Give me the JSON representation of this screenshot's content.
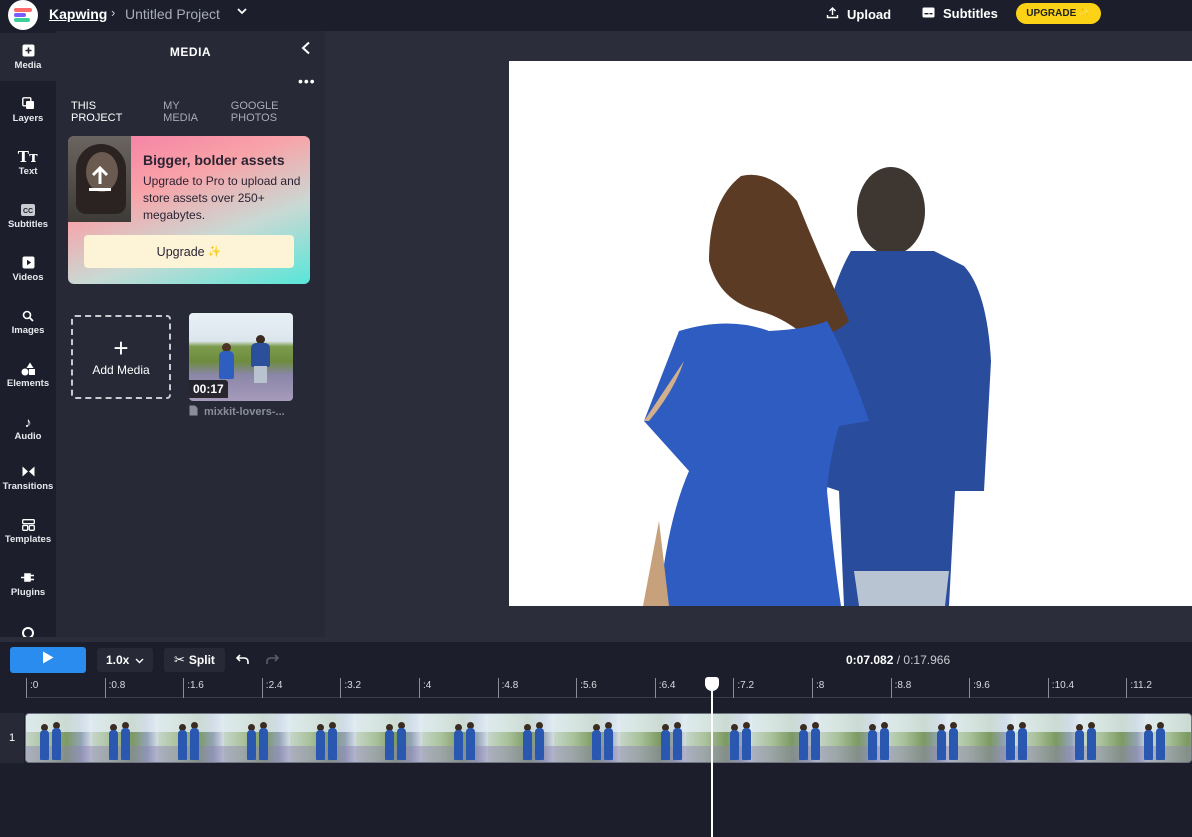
{
  "header": {
    "brand": "Kapwing",
    "separator": "›",
    "project_name": "Untitled Project",
    "upload_label": "Upload",
    "subtitles_label": "Subtitles",
    "upgrade_label": "UPGRADE",
    "accent_color": "#fcd217"
  },
  "rail": {
    "items": [
      {
        "label": "Media",
        "icon": "media-icon"
      },
      {
        "label": "Layers",
        "icon": "layers-icon"
      },
      {
        "label": "Text",
        "icon": "text-icon"
      },
      {
        "label": "Subtitles",
        "icon": "cc-icon"
      },
      {
        "label": "Videos",
        "icon": "video-icon"
      },
      {
        "label": "Images",
        "icon": "search-icon"
      },
      {
        "label": "Elements",
        "icon": "shapes-icon"
      },
      {
        "label": "Audio",
        "icon": "music-note-icon"
      },
      {
        "label": "Transitions",
        "icon": "transition-icon"
      },
      {
        "label": "Templates",
        "icon": "templates-icon"
      },
      {
        "label": "Plugins",
        "icon": "plug-icon"
      }
    ]
  },
  "panel": {
    "title": "MEDIA",
    "tabs": [
      "THIS PROJECT",
      "MY MEDIA",
      "GOOGLE PHOTOS"
    ],
    "promo": {
      "title": "Bigger, bolder assets",
      "text": "Upgrade to Pro to upload and store assets over 250+ megabytes.",
      "button": "Upgrade"
    },
    "add_media_label": "Add Media",
    "media_items": [
      {
        "name": "mixkit-lovers-...",
        "duration": "00:17"
      }
    ]
  },
  "timeline": {
    "speed": "1.0x",
    "split_label": "Split",
    "current_time": "0:07.082",
    "total_time": "0:17.966",
    "separator": "/",
    "track_number": "1",
    "ticks": [
      ":0",
      ":0.8",
      ":1.6",
      ":2.4",
      ":3.2",
      ":4",
      ":4.8",
      ":5.6",
      ":6.4",
      ":7.2",
      ":8",
      ":8.8",
      ":9.6",
      ":10.4",
      ":11.2"
    ],
    "play_color": "#2b8cf0"
  }
}
